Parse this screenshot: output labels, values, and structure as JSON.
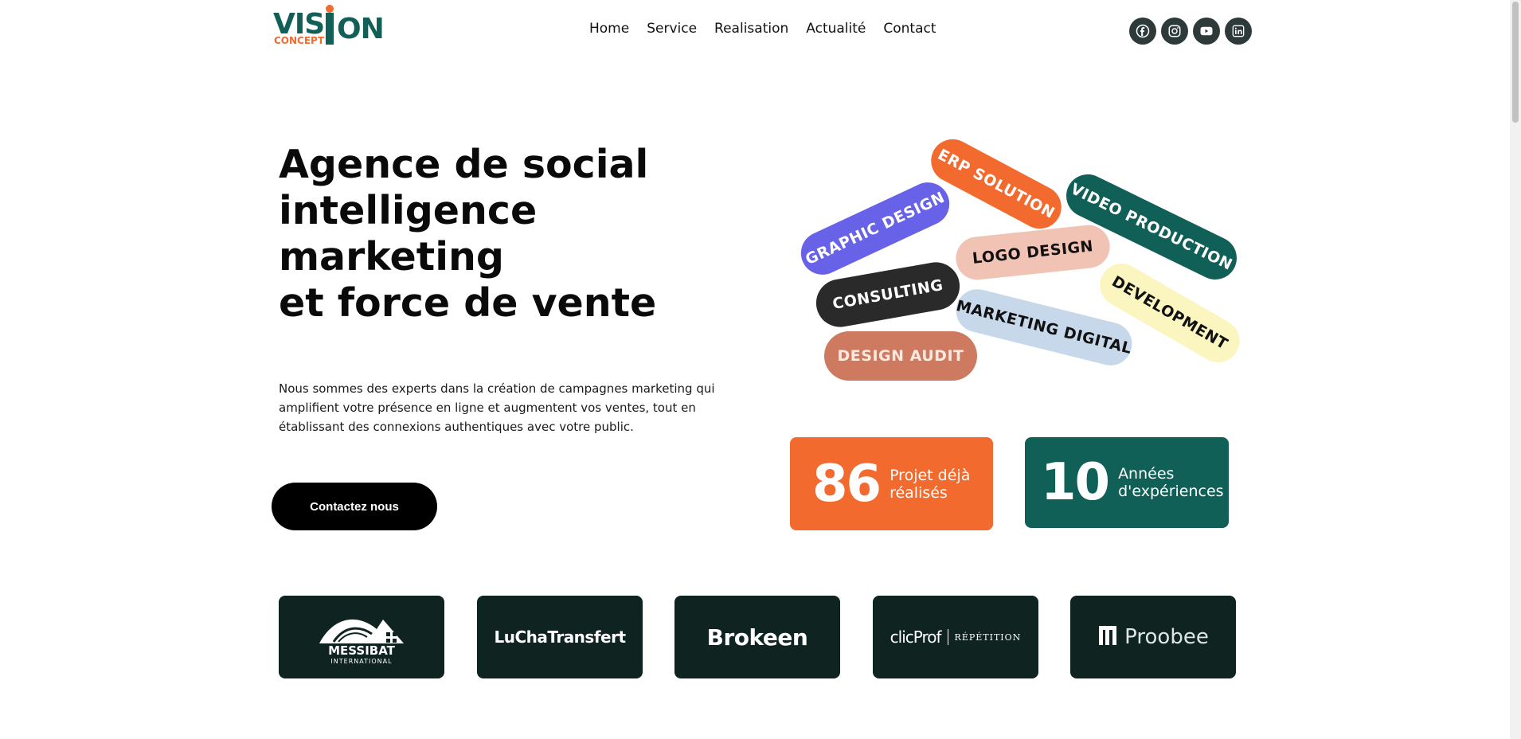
{
  "brand": {
    "logo_main": "VISION",
    "logo_sub": "CONCEPT",
    "colors": {
      "green": "#116057",
      "orange": "#f26a2e"
    }
  },
  "nav": {
    "items": [
      "Home",
      "Service",
      "Realisation",
      "Actualité",
      "Contact"
    ]
  },
  "social": [
    "facebook-icon",
    "instagram-icon",
    "youtube-icon",
    "linkedin-icon"
  ],
  "hero": {
    "title_lines": [
      "Agence de social",
      "intelligence",
      "marketing",
      "et force de vente"
    ],
    "description": "Nous sommes des experts dans la création de campagnes marketing qui amplifient votre présence en ligne et augmentent vos ventes, tout en établissant des connexions authentiques avec votre public.",
    "cta_label": "Contactez nous"
  },
  "services": [
    {
      "label": "ERP SOLUTION",
      "color": "#f26a2e",
      "text_color": "#ffffff"
    },
    {
      "label": "GRAPHIC DESIGN",
      "color": "#6762e8",
      "text_color": "#ffffff"
    },
    {
      "label": "VIDEO PRODUCTION",
      "color": "#116057",
      "text_color": "#ffffff"
    },
    {
      "label": "LOGO DESIGN",
      "color": "#f1c3b4",
      "text_color": "#111111"
    },
    {
      "label": "CONSULTING",
      "color": "#2a2a2a",
      "text_color": "#ffffff"
    },
    {
      "label": "DEVELOPMENT",
      "color": "#fbf5c0",
      "text_color": "#111111"
    },
    {
      "label": "MARKETING DIGITAL",
      "color": "#c7d8ea",
      "text_color": "#111111"
    },
    {
      "label": "DESIGN AUDIT",
      "color": "#cd7a60",
      "text_color": "#ffe9df"
    }
  ],
  "stats": [
    {
      "value": "86",
      "label": "Projet déjà réalisés",
      "color": "#f26a2e"
    },
    {
      "value": "10",
      "label": "Années d'expériences",
      "color": "#116057"
    }
  ],
  "clients": [
    "MESSIBAT",
    "LuChaTransfert",
    "Brokeen",
    "clicProf",
    "Proobee"
  ],
  "client_extras": {
    "messibat_sub": "INTERNATIONAL",
    "clicprof_sub": "RÉPÉTITION"
  }
}
